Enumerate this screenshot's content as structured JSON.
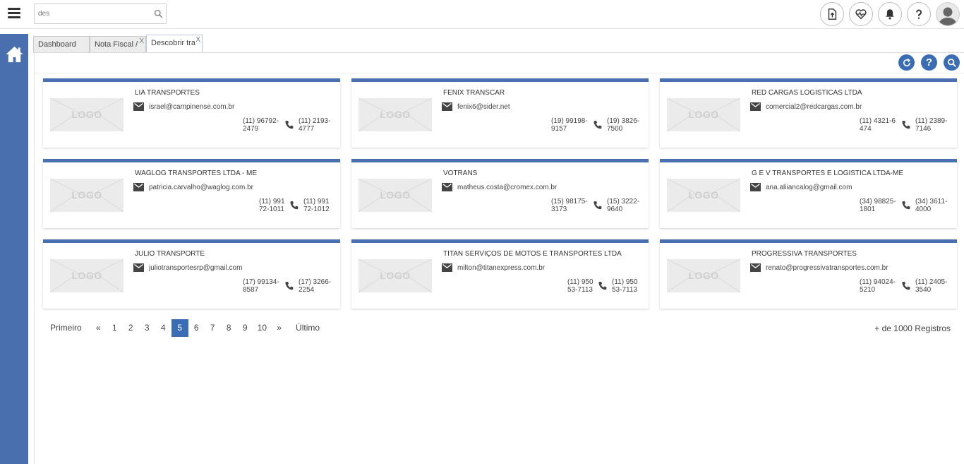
{
  "search": {
    "value": "des",
    "placeholder": ""
  },
  "header_icons": [
    "upload-file-icon",
    "health-heart-icon",
    "bell-icon",
    "help-icon",
    "user-avatar-icon"
  ],
  "tabs": [
    {
      "label": "Dashboard",
      "closable": false
    },
    {
      "label": "Nota Fiscal / I",
      "closable": true
    },
    {
      "label": "Descobrir tra",
      "closable": true
    }
  ],
  "tab_close_label": "X",
  "logo_placeholder": "LOGO",
  "cards": [
    {
      "name": "LIA TRANSPORTES",
      "email": "israel@campinense.com.br",
      "phone1": "(11) 96792-2479",
      "phone2": "(11) 2193-4777"
    },
    {
      "name": "FENIX TRANSCAR",
      "email": "fenix6@sider.net",
      "phone1": "(19) 99198-9157",
      "phone2": "(19) 3826-7500"
    },
    {
      "name": "RED CARGAS LOGISTICAS LTDA",
      "email": "comercial2@redcargas.com.br",
      "phone1": "(11) 4321-6474",
      "phone2": "(11) 2389-7146"
    },
    {
      "name": "WAGLOG TRANSPORTES LTDA - ME",
      "email": "patricia.carvalho@waglog.com.br",
      "phone1": "(11) 99172-1011",
      "phone2": "(11) 99172-1012"
    },
    {
      "name": "VOTRANS",
      "email": "matheus.costa@cromex.com.br",
      "phone1": "(15) 98175-3173",
      "phone2": "(15) 3222-9640"
    },
    {
      "name": "G E V TRANSPORTES E LOGISTICA LTDA-ME",
      "email": "ana.aliiancalog@gmail.com",
      "phone1": "(34) 98825-1801",
      "phone2": "(34) 3611-4000"
    },
    {
      "name": "JULIO TRANSPORTE",
      "email": "juliotransportesrp@gmail.com",
      "phone1": "(17) 99134-8587",
      "phone2": "(17) 3266-2254"
    },
    {
      "name": "TITAN SERVIÇOS DE MOTOS E TRANSPORTES LTDA",
      "email": "milton@titanexpress.com.br",
      "phone1": "(11) 95053-7113",
      "phone2": "(11) 95053-7113"
    },
    {
      "name": "PROGRESSIVA TRANSPORTES",
      "email": "renato@progressivatransportes.com.br",
      "phone1": "(11) 94024-5210",
      "phone2": "(11) 2405-3540"
    }
  ],
  "pagination": {
    "first": "Primeiro",
    "prev": "«",
    "pages": [
      "1",
      "2",
      "3",
      "4",
      "5",
      "6",
      "7",
      "8",
      "9",
      "10"
    ],
    "current": "5",
    "next": "»",
    "last": "Último"
  },
  "records": "+ de 1000 Registros",
  "colors": {
    "sidebar": "#4a6fae",
    "accent": "#3a6db3",
    "card_border": "#4a6fae"
  }
}
